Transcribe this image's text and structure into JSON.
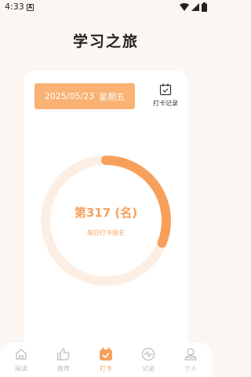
{
  "status_bar": {
    "time": "4:33",
    "badge": "A"
  },
  "page": {
    "title": "学习之旅"
  },
  "card": {
    "date": "2025/05/23",
    "weekday": "星期五",
    "record_label": "打卡记录"
  },
  "ring": {
    "progress_fraction": 0.31,
    "track_color": "#FDEEE3",
    "progress_color": "#F7A05C"
  },
  "rank": {
    "text": "第317 (名)",
    "label": "每日打卡排名"
  },
  "nav": {
    "items": [
      {
        "label": "阅读",
        "icon": "home-icon",
        "active": false
      },
      {
        "label": "推荐",
        "icon": "thumbs-up-icon",
        "active": false
      },
      {
        "label": "打卡",
        "icon": "checkin-icon",
        "active": true
      },
      {
        "label": "记录",
        "icon": "activity-icon",
        "active": false
      },
      {
        "label": "个人",
        "icon": "person-icon",
        "active": false
      }
    ]
  },
  "colors": {
    "accent": "#F7A05C",
    "date_button": "#F9B273",
    "background": "#FBF6F2"
  }
}
